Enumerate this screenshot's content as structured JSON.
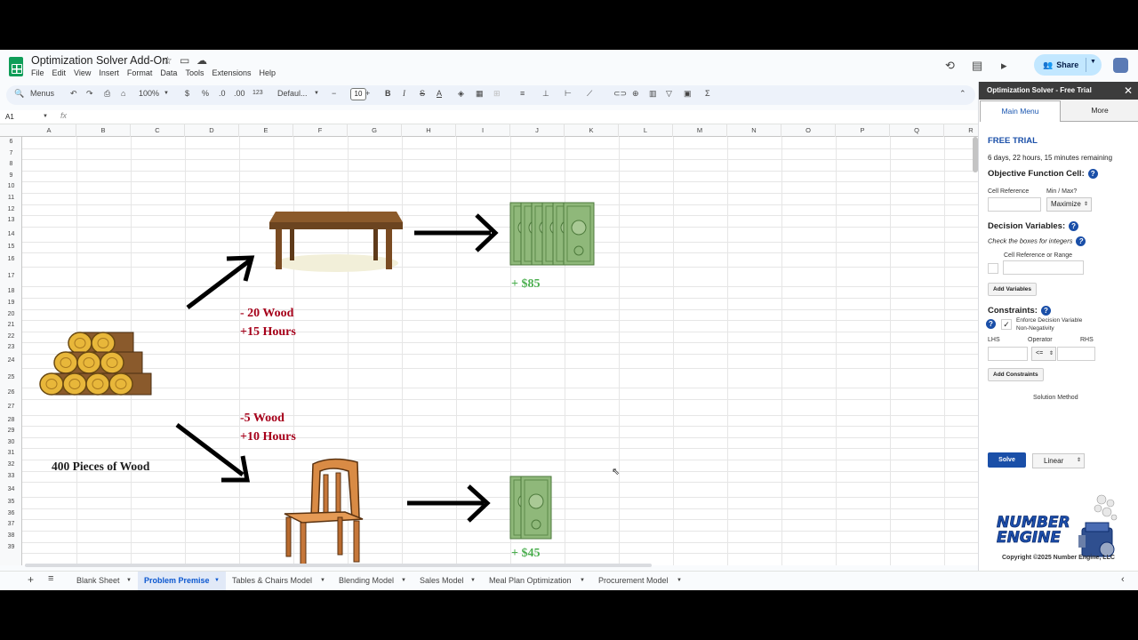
{
  "doc": {
    "title": "Optimization Solver Add-On",
    "menus": [
      "File",
      "Edit",
      "View",
      "Insert",
      "Format",
      "Data",
      "Tools",
      "Extensions",
      "Help"
    ],
    "share_label": "Share"
  },
  "toolbar": {
    "menus_label": "Menus",
    "zoom": "100%",
    "currency": "$",
    "percent": "%",
    "decimal_less": ".0",
    "decimal_more": ".00",
    "number_format": "123",
    "font": "Defaul...",
    "font_size": "10"
  },
  "formula_bar": {
    "cell_ref": "A1",
    "fx": "fx"
  },
  "grid": {
    "columns": [
      "A",
      "B",
      "C",
      "D",
      "E",
      "F",
      "G",
      "H",
      "I",
      "J",
      "K",
      "L",
      "M",
      "N",
      "O",
      "P",
      "Q",
      "R"
    ],
    "rows": [
      "6",
      "7",
      "8",
      "9",
      "10",
      "11",
      "12",
      "13",
      "14",
      "15",
      "16",
      "17",
      "18",
      "19",
      "20",
      "21",
      "22",
      "23",
      "24",
      "25",
      "26",
      "27",
      "28",
      "29",
      "30",
      "31",
      "32",
      "33",
      "34",
      "35",
      "36",
      "37",
      "38",
      "39"
    ]
  },
  "premise": {
    "table_cost_wood": "- 20 Wood",
    "table_cost_hours": "+15 Hours",
    "table_profit": "+ $85",
    "chair_cost_wood": "-5 Wood",
    "chair_cost_hours": "+10 Hours",
    "chair_profit": "+ $45",
    "wood_supply": "400 Pieces of Wood"
  },
  "sheet_tabs": [
    "Blank Sheet",
    "Problem Premise",
    "Tables & Chairs Model",
    "Blending Model",
    "Sales Model",
    "Meal Plan Optimization",
    "Procurement Model"
  ],
  "active_tab": "Problem Premise",
  "sidebar": {
    "title": "Optimization Solver - Free Trial",
    "tabs": [
      "Main Menu",
      "More"
    ],
    "trial_heading": "FREE TRIAL",
    "trial_remaining": "6 days, 22 hours, 15 minutes remaining",
    "objective_heading": "Objective Function Cell:",
    "cell_reference_label": "Cell Reference",
    "minmax_label": "Min / Max?",
    "minmax_value": "Maximize",
    "decision_heading": "Decision Variables:",
    "integers_note": "Check the boxes for integers",
    "cell_range_label": "Cell Reference or Range",
    "add_variables": "Add Variables",
    "constraints_heading": "Constraints:",
    "nonneg_line1": "Enforce Decision Variable",
    "nonneg_line2": "Non-Negativity",
    "lhs_label": "LHS",
    "operator_label": "Operator",
    "rhs_label": "RHS",
    "operator_value": "<=",
    "add_constraints": "Add Constraints",
    "solution_method_label": "Solution Method",
    "solve": "Solve",
    "method_value": "Linear",
    "brand_line1": "NUMBER",
    "brand_line2": "ENGINE",
    "copyright": "Copyright ©2025 Number Engine, LLC"
  },
  "colors": {
    "accent": "#1a4fa8",
    "cost_red": "#a6001a",
    "profit_green": "#4caf50",
    "share_bg": "#c2e7ff"
  }
}
